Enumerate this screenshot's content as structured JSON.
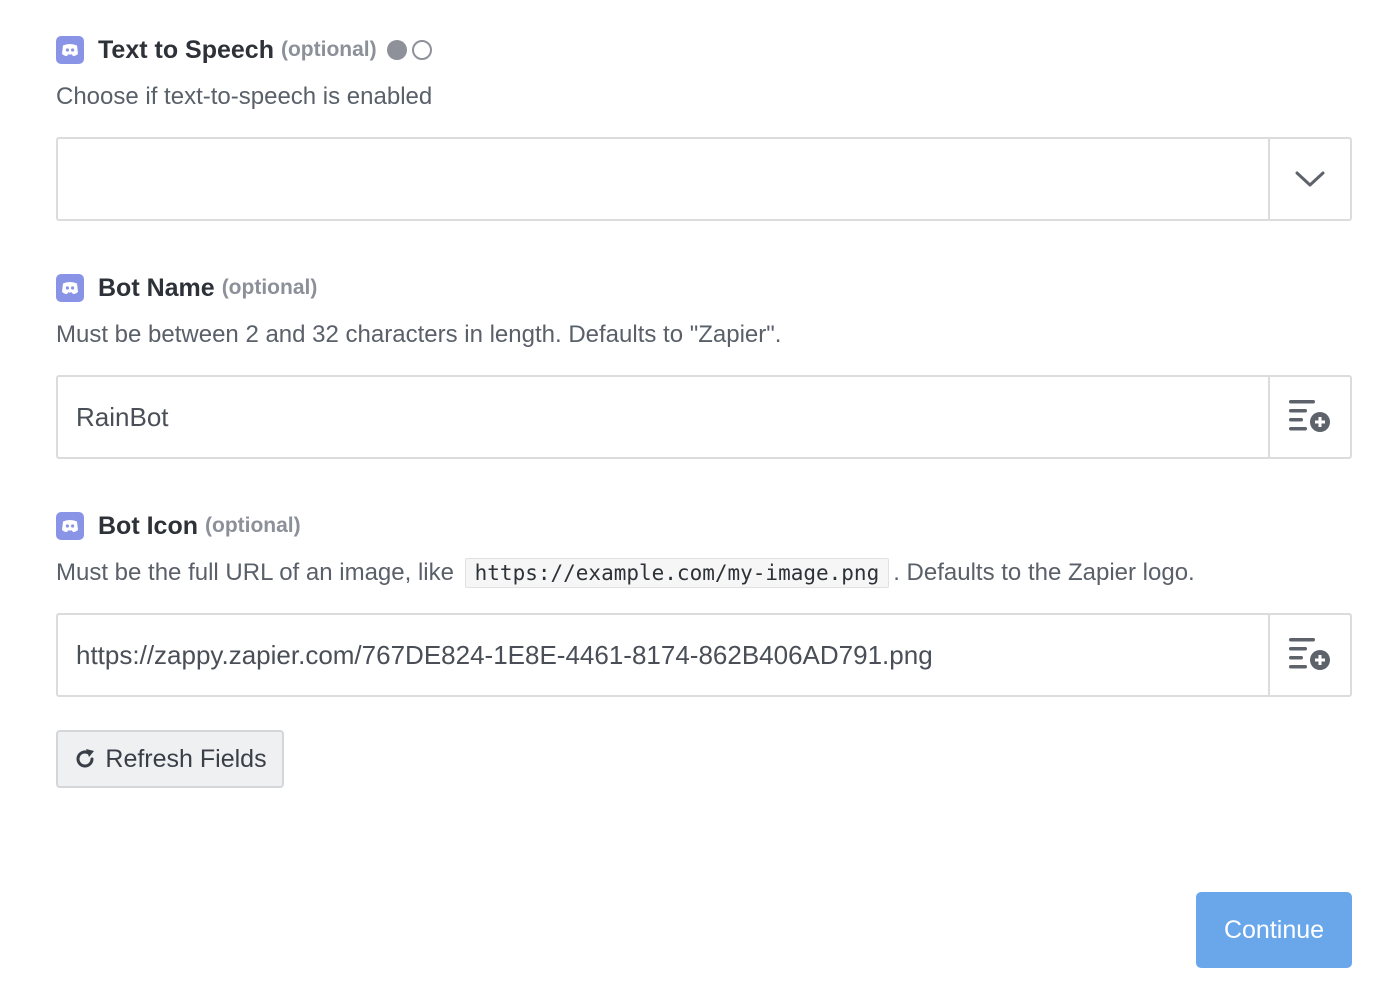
{
  "fields": [
    {
      "label": "Text to Speech",
      "optional": "(optional)",
      "help": "Choose if text-to-speech is enabled",
      "value": "",
      "control": "dropdown",
      "side_icon": "chevron-down-icon"
    },
    {
      "label": "Bot Name",
      "optional": "(optional)",
      "help": "Must be between 2 and 32 characters in length. Defaults to \"Zapier\".",
      "value": "RainBot",
      "control": "text",
      "side_icon": "insert-data-icon"
    },
    {
      "label": "Bot Icon",
      "optional": "(optional)",
      "help_before": "Must be the full URL of an image, like",
      "help_code": "https://example.com/my-image.png",
      "help_after": ". Defaults to the Zapier logo.",
      "value": "https://zappy.zapier.com/767DE824-1E8E-4461-8174-862B406AD791.png",
      "control": "text",
      "side_icon": "insert-data-icon"
    }
  ],
  "buttons": {
    "refresh_label": "Refresh Fields",
    "continue_label": "Continue"
  },
  "colors": {
    "app_icon": "#8a94e6",
    "continue_bg": "#69a7ea",
    "border": "#dcdcdc"
  },
  "icons": [
    "discord-icon",
    "mode-toggle-icon",
    "chevron-down-icon",
    "insert-data-icon",
    "refresh-icon"
  ]
}
